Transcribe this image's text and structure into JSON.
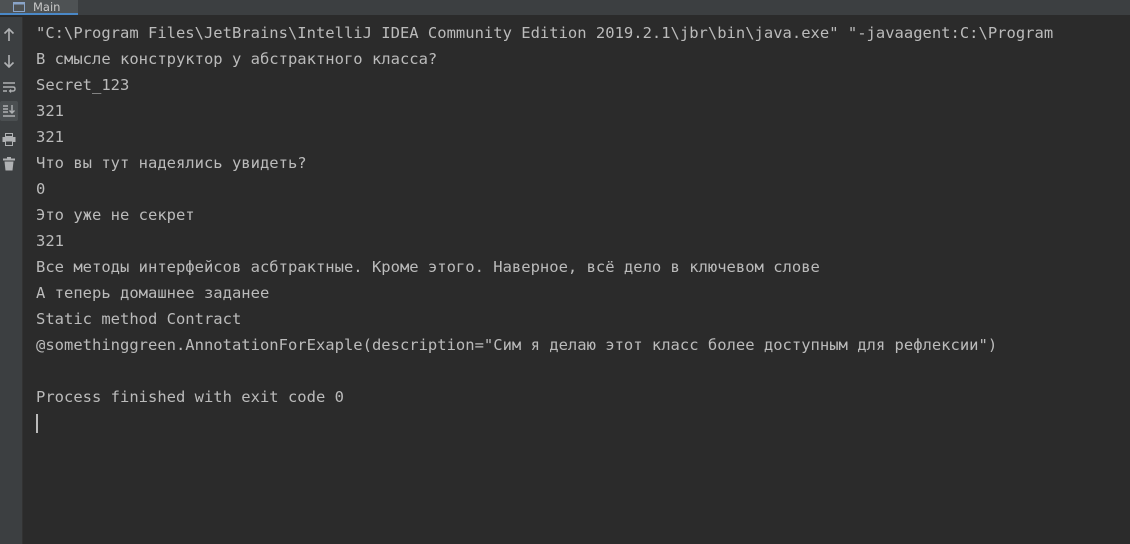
{
  "run_tab": {
    "label": "Main",
    "icon": "console-window-icon"
  },
  "toolbar": {
    "items": [
      {
        "name": "up-arrow-icon"
      },
      {
        "name": "down-arrow-icon"
      },
      {
        "name": "soft-wrap-icon"
      },
      {
        "name": "scroll-to-end-icon"
      },
      {
        "name": "print-icon"
      },
      {
        "name": "trash-icon"
      }
    ]
  },
  "console": {
    "lines": [
      "\"C:\\Program Files\\JetBrains\\IntelliJ IDEA Community Edition 2019.2.1\\jbr\\bin\\java.exe\" \"-javaagent:C:\\Program",
      "В смысле конструктор у абстрактного класса?",
      "Secret_123",
      "321",
      "321",
      "Что вы тут надеялись увидеть?",
      "0",
      "Это уже не секрет",
      "321",
      "Все методы интерфейсов асбтрактные. Кроме этого. Наверное, всё дело в ключевом слове",
      "А теперь домашнее заданее",
      "Static method Contract",
      "@somethinggreen.AnnotationForExaple(description=\"Сим я делаю этот класс более доступным для рефлексии\")",
      "",
      "Process finished with exit code 0"
    ]
  },
  "colors": {
    "background": "#2b2b2b",
    "panel": "#3c3f41",
    "text": "#bbbbbb",
    "accent": "#4a88c7"
  }
}
